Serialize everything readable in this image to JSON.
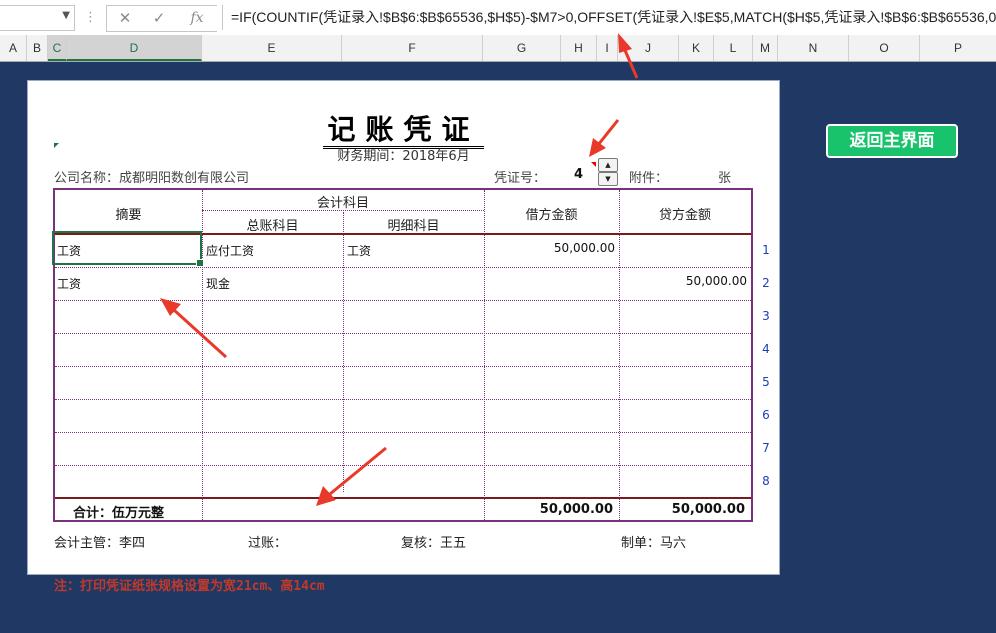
{
  "formula_bar": {
    "formula": "=IF(COUNTIF(凭证录入!$B$6:$B$65536,$H$5)-$M7>0,OFFSET(凭证录入!$E$5,MATCH($H$5,凭证录入!$B$6:$B$65536,0",
    "fx_label": "fx",
    "cancel_icon": "✕",
    "confirm_icon": "✓"
  },
  "columns": [
    "A",
    "B",
    "C",
    "D",
    "E",
    "F",
    "G",
    "H",
    "I",
    "J",
    "K",
    "L",
    "M",
    "N",
    "O",
    "P"
  ],
  "voucher": {
    "title": "记账凭证",
    "period": "财务期间：2018年6月",
    "company": "公司名称：成都明阳数创有限公司",
    "voucher_no_label": "凭证号：",
    "voucher_no": "4",
    "attach_label": "附件：",
    "attach_unit": "张",
    "headers": {
      "summary": "摘要",
      "account": "会计科目",
      "general_account": "总账科目",
      "detail_account": "明细科目",
      "debit": "借方金额",
      "credit": "贷方金额"
    },
    "rows": [
      {
        "summary": "工资",
        "general": "应付工资",
        "detail": "工资",
        "debit": "50,000.00",
        "credit": ""
      },
      {
        "summary": "工资",
        "general": "现金",
        "detail": "",
        "debit": "",
        "credit": "50,000.00"
      },
      {
        "summary": "",
        "general": "",
        "detail": "",
        "debit": "",
        "credit": ""
      },
      {
        "summary": "",
        "general": "",
        "detail": "",
        "debit": "",
        "credit": ""
      },
      {
        "summary": "",
        "general": "",
        "detail": "",
        "debit": "",
        "credit": ""
      },
      {
        "summary": "",
        "general": "",
        "detail": "",
        "debit": "",
        "credit": ""
      },
      {
        "summary": "",
        "general": "",
        "detail": "",
        "debit": "",
        "credit": ""
      },
      {
        "summary": "",
        "general": "",
        "detail": "",
        "debit": "",
        "credit": ""
      }
    ],
    "row_numbers": [
      "1",
      "2",
      "3",
      "4",
      "5",
      "6",
      "7",
      "8"
    ],
    "total_label": "合计：伍万元整",
    "total_debit": "50,000.00",
    "total_credit": "50,000.00",
    "signatures": {
      "supervisor": "会计主管：李四",
      "posting": "过账：",
      "review": "复核：王五",
      "maker": "制单：马六"
    }
  },
  "note": "注：打印凭证纸张规格设置为宽21cm、高14cm",
  "back_button": "返回主界面",
  "colors": {
    "background": "#1f3864",
    "border": "#7a2f7f",
    "button": "#18c36c",
    "arrow": "#e8392a",
    "note": "#c0392b"
  }
}
